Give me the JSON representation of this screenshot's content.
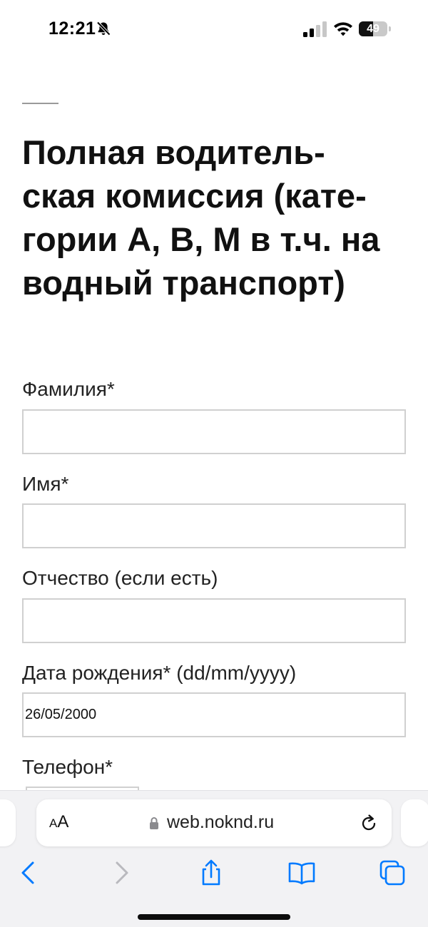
{
  "status_bar": {
    "time": "12:21",
    "battery_level": "49",
    "battery_percent": 49,
    "icons": [
      "bell-slash-icon",
      "cellular-signal-icon",
      "wifi-icon",
      "battery-icon"
    ]
  },
  "page": {
    "title_lines": [
      "Полная водитель-",
      "ская комиссия (кате-",
      "гории А, В, М в т.ч. на",
      "водный транспорт)"
    ]
  },
  "form": {
    "fields": [
      {
        "label": "Фамилия*",
        "value": ""
      },
      {
        "label": "Имя*",
        "value": ""
      },
      {
        "label": "Отчество (если есть)",
        "value": ""
      },
      {
        "label": "Дата рождения* (dd/mm/yyyy)",
        "value": "26/05/2000"
      },
      {
        "label": "Телефон*",
        "value": ""
      }
    ]
  },
  "browser": {
    "text_size_small": "A",
    "text_size_big": "A",
    "url": "web.noknd.ru",
    "icons": [
      "lock-icon",
      "reload-icon",
      "back-icon",
      "forward-icon",
      "share-icon",
      "bookmarks-icon",
      "tabs-icon"
    ]
  },
  "colors": {
    "accent_line": "#9a9a9a",
    "input_border": "#d0d0d0",
    "toolbar_bg": "#f2f2f4",
    "ios_blue": "#007aff"
  }
}
